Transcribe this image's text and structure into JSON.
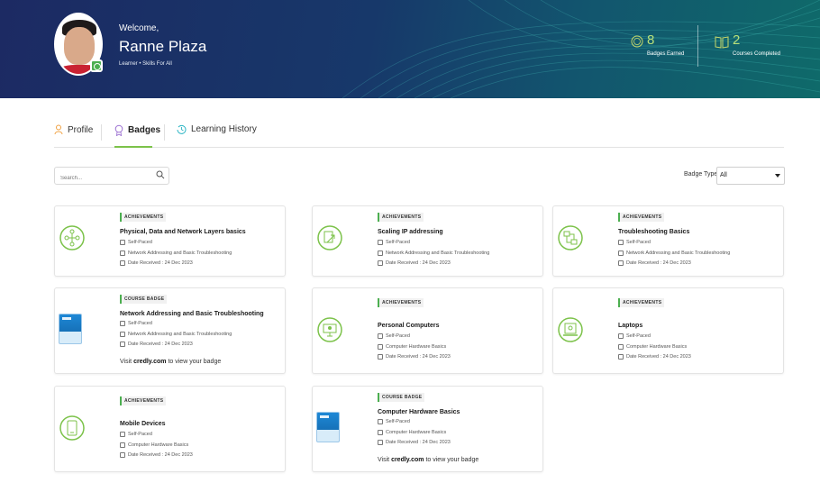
{
  "header": {
    "welcome": "Welcome,",
    "name": "Ranne Plaza",
    "role": "Learner",
    "separator": "•",
    "program": "Skills For All",
    "stats": {
      "badges_count": "8",
      "badges_label": "Badges Earned",
      "courses_count": "2",
      "courses_label": "Courses Completed"
    },
    "accent_color": "#b7e07a"
  },
  "tabs": [
    {
      "label": "Profile",
      "icon": "person-icon",
      "active": false
    },
    {
      "label": "Badges",
      "icon": "badge-icon",
      "active": true
    },
    {
      "label": "Learning History",
      "icon": "history-icon",
      "active": false
    }
  ],
  "filters": {
    "search_placeholder": "Search...",
    "badge_type_label": "Badge Type",
    "badge_type_value": "All"
  },
  "cards": [
    {
      "category": "ACHIEVEMENTS",
      "title": "Physical, Data and Network Layers basics",
      "pace": "Self-Paced",
      "course": "Network Addressing and Basic Troubleshooting",
      "date": "Date Received : 24 Dec 2023",
      "icon": "network-layers-icon"
    },
    {
      "category": "ACHIEVEMENTS",
      "title": "Scaling IP addressing",
      "pace": "Self-Paced",
      "course": "Network Addressing and Basic Troubleshooting",
      "date": "Date Received : 24 Dec 2023",
      "icon": "ip-scaling-icon"
    },
    {
      "category": "ACHIEVEMENTS",
      "title": "Troubleshooting Basics",
      "pace": "Self-Paced",
      "course": "Network Addressing and Basic Troubleshooting",
      "date": "Date Received : 24 Dec 2023",
      "icon": "troubleshooting-icon"
    },
    {
      "category": "COURSE BADGE",
      "title": "Network Addressing and Basic Troubleshooting",
      "pace": "Self-Paced",
      "course": "Network Addressing and Basic Troubleshooting",
      "date": "Date Received : 24 Dec 2023",
      "credly_prefix": "Visit",
      "credly_link": "credly.com",
      "credly_suffix": "to view your badge",
      "icon": "course-badge-icon"
    },
    {
      "category": "ACHIEVEMENTS",
      "title": "Personal Computers",
      "pace": "Self-Paced",
      "course": "Computer Hardware Basics",
      "date": "Date Received : 24 Dec 2023",
      "icon": "personal-computer-icon"
    },
    {
      "category": "ACHIEVEMENTS",
      "title": "Laptops",
      "pace": "Self-Paced",
      "course": "Computer Hardware Basics",
      "date": "Date Received : 24 Dec 2023",
      "icon": "laptop-icon"
    },
    {
      "category": "ACHIEVEMENTS",
      "title": "Mobile Devices",
      "pace": "Self-Paced",
      "course": "Computer Hardware Basics",
      "date": "Date Received : 24 Dec 2023",
      "icon": "mobile-device-icon"
    },
    {
      "category": "COURSE BADGE",
      "title": "Computer Hardware Basics",
      "pace": "Self-Paced",
      "course": "Computer Hardware Basics",
      "date": "Date Received : 24 Dec 2023",
      "credly_prefix": "Visit",
      "credly_link": "credly.com",
      "credly_suffix": "to view your badge",
      "icon": "course-badge-icon"
    }
  ]
}
